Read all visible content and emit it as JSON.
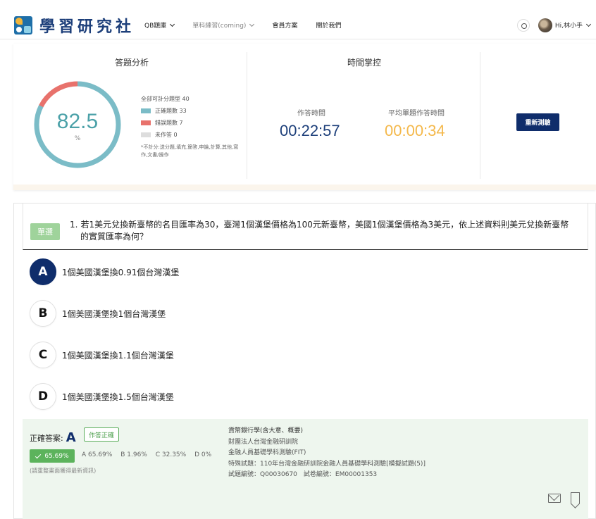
{
  "header": {
    "logo_text": "學習研究社",
    "nav": [
      {
        "label": "QB題庫",
        "muted": false,
        "has_menu": true
      },
      {
        "label": "單科練習(coming)",
        "muted": true,
        "has_menu": true
      },
      {
        "label": "會員方案",
        "muted": false,
        "has_menu": false
      },
      {
        "label": "關於我們",
        "muted": false,
        "has_menu": false
      }
    ],
    "user_greeting": "Hi,林小手"
  },
  "analysis": {
    "title": "答題分析",
    "score": "82.5",
    "unit": "%",
    "total_label": "全部可計分題型 40",
    "correct_label": "正確題數 33",
    "wrong_label": "錯誤題數 7",
    "unanswered_label": "未作答 0",
    "correct": 33,
    "wrong": 7,
    "unanswered": 0,
    "note": "*不計分:送分題,填充,簡答,申論,計算,其他,寫作,文書/操作",
    "colors": {
      "correct": "#7bbcc7",
      "wrong": "#e8726c",
      "unanswered": "#dddddd"
    }
  },
  "time": {
    "title": "時間掌控",
    "elapsed_label": "作答時間",
    "elapsed_value": "00:22:57",
    "avg_label": "平均單題作答時間",
    "avg_value": "00:00:34",
    "colors": {
      "elapsed": "#1d3f7a",
      "avg": "#f4b84a"
    }
  },
  "retest_button": "重新測驗",
  "question": {
    "type": "單選",
    "number": "1.",
    "text_line1": "若1美元兌換新臺幣的名目匯率為30，臺灣1個漢堡價格為100元新臺幣，美國1個漢堡價格為3美元，依上述資料則美元兌換新臺幣",
    "text_line2": "的實質匯率為何？",
    "options": [
      {
        "letter": "A",
        "text": "1個美國漢堡換0.91個台灣漢堡",
        "selected": true
      },
      {
        "letter": "B",
        "text": "1個美國漢堡換1個台灣漢堡",
        "selected": false
      },
      {
        "letter": "C",
        "text": "1個美國漢堡換1.1個台灣漢堡",
        "selected": false
      },
      {
        "letter": "D",
        "text": "1個美國漢堡換1.5個台灣漢堡",
        "selected": false
      }
    ]
  },
  "answer": {
    "label": "正確答案:",
    "letter": "A",
    "status": "作答正確",
    "correct_pct": "65.69%",
    "distribution": [
      "A 65.69%",
      "B 1.96%",
      "C 32.35%",
      "D 0%"
    ],
    "refresh_note": "(請重整畫面獲得最新資訊)",
    "meta": {
      "subject": "貨幣銀行學(含大意、概要)",
      "org": "財團法人台灣金融研訓院",
      "exam": "金融人員基礎學科測驗(FIT)",
      "special": "特殊試題：110年台灣金融研訓院金融人員基礎學科測驗[模擬試題(5)]",
      "ids": "試題編號：Q00030670　試卷編號：EM00001353"
    }
  }
}
